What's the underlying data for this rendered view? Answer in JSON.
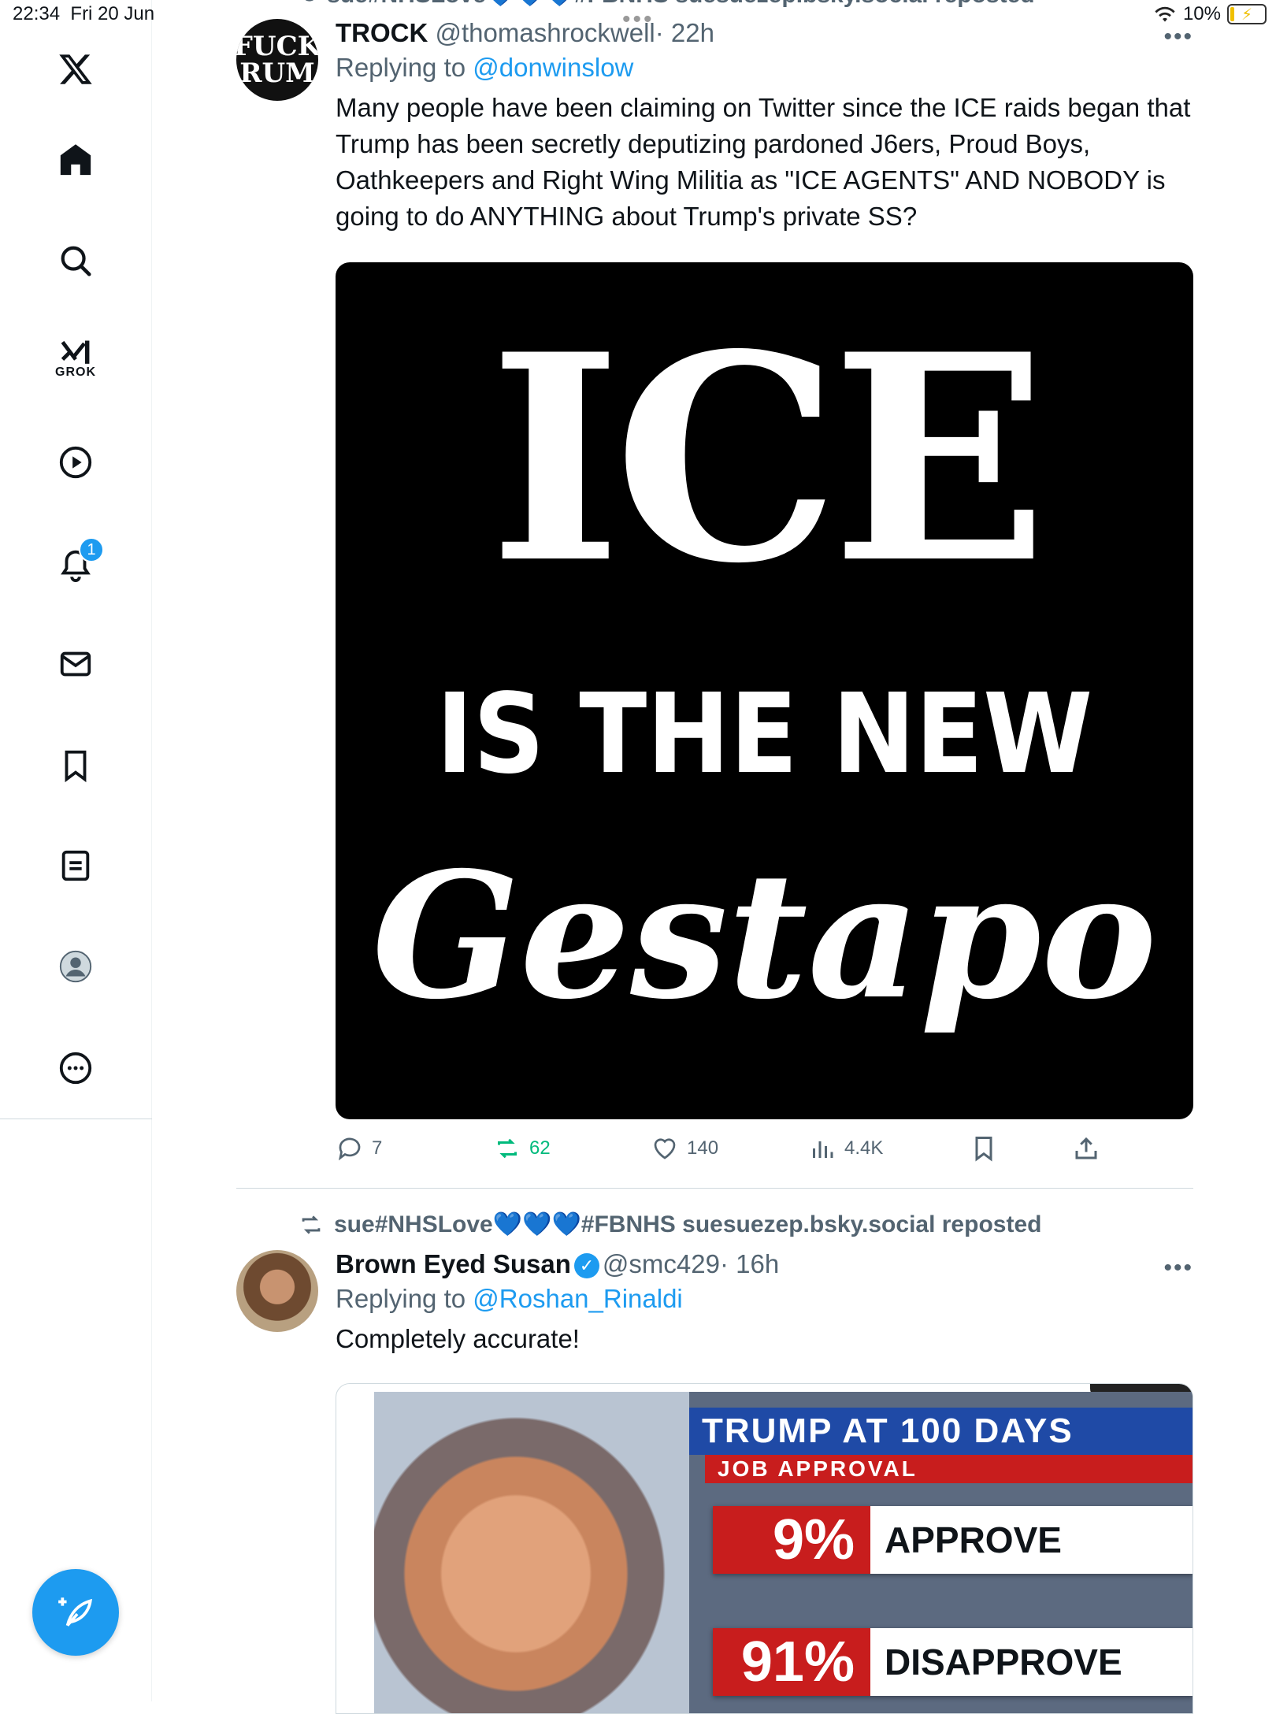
{
  "status_bar": {
    "time": "22:34",
    "date": "Fri 20 Jun",
    "battery": "10%"
  },
  "sidebar": {
    "items": [
      {
        "name": "x-logo"
      },
      {
        "name": "home"
      },
      {
        "name": "explore"
      },
      {
        "name": "grok",
        "label": "GROK"
      },
      {
        "name": "video"
      },
      {
        "name": "notifications",
        "badge": "1"
      },
      {
        "name": "messages"
      },
      {
        "name": "bookmarks"
      },
      {
        "name": "lists"
      },
      {
        "name": "profile"
      },
      {
        "name": "more"
      }
    ],
    "compose_icon": "feather-plus-icon",
    "accent": "#1d9bf0"
  },
  "feed": {
    "tweets": [
      {
        "repost_header": "sue#NHSLove💙💙💙#FBNHS suesuezep.bsky.social reposted",
        "name": "TROCK",
        "handle": "@thomashrockwell",
        "time": "· 22h",
        "avatar_text": [
          "FUCK",
          "RUM"
        ],
        "replying_prefix": "Replying to",
        "replying_to": "@donwinslow",
        "text": "Many people have been claiming on Twitter since the ICE raids began that Trump has been secretly deputizing pardoned J6ers, Proud Boys, Oathkeepers and Right Wing Militia as \"ICE AGENTS\" AND NOBODY is going to do ANYTHING about Trump's private SS?",
        "media_text": {
          "line1": "ICE",
          "line2": "IS THE NEW",
          "line3": "Gestapo"
        },
        "stats": {
          "replies": "7",
          "reposts": "62",
          "likes": "140",
          "views": "4.4K"
        },
        "repost_color": "#00ba7c"
      },
      {
        "repost_header": "sue#NHSLove💙💙💙#FBNHS suesuezep.bsky.social reposted",
        "name": "Brown Eyed Susan",
        "verified": true,
        "handle": "@smc429",
        "time": "· 16h",
        "replying_prefix": "Replying to",
        "replying_to": "@Roshan_Rinaldi",
        "text": "Completely accurate!",
        "media_text": {
          "title": "TRUMP AT 100 DAYS",
          "subtitle": "JOB APPROVAL",
          "approve_pct": "9%",
          "approve_label": "APPROVE",
          "disapprove_pct": "91%",
          "disapprove_label": "DISAPPROVE"
        }
      }
    ]
  }
}
